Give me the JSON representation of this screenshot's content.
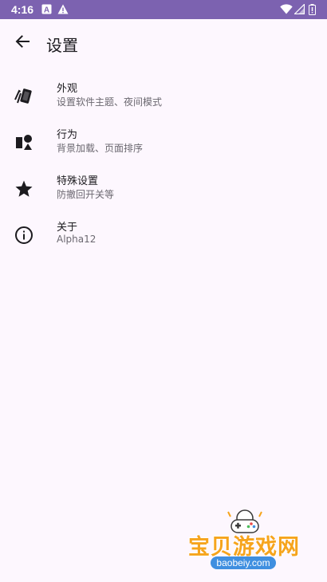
{
  "status_bar": {
    "time": "4:16"
  },
  "app_bar": {
    "title": "设置"
  },
  "items": [
    {
      "title": "外观",
      "subtitle": "设置软件主题、夜间模式",
      "icon": "palette-cards-icon"
    },
    {
      "title": "行为",
      "subtitle": "背景加载、页面排序",
      "icon": "shapes-icon"
    },
    {
      "title": "特殊设置",
      "subtitle": "防撤回开关等",
      "icon": "star-icon"
    },
    {
      "title": "关于",
      "subtitle": "Alpha12",
      "icon": "info-icon"
    }
  ],
  "watermark": {
    "brand": "宝贝游戏网",
    "url": "baobeiy.com"
  },
  "colors": {
    "status_bar": "#7c62b0",
    "background": "#fdf7fe",
    "watermark_orange": "#f6a41c",
    "watermark_blue": "#3f8fe0"
  }
}
